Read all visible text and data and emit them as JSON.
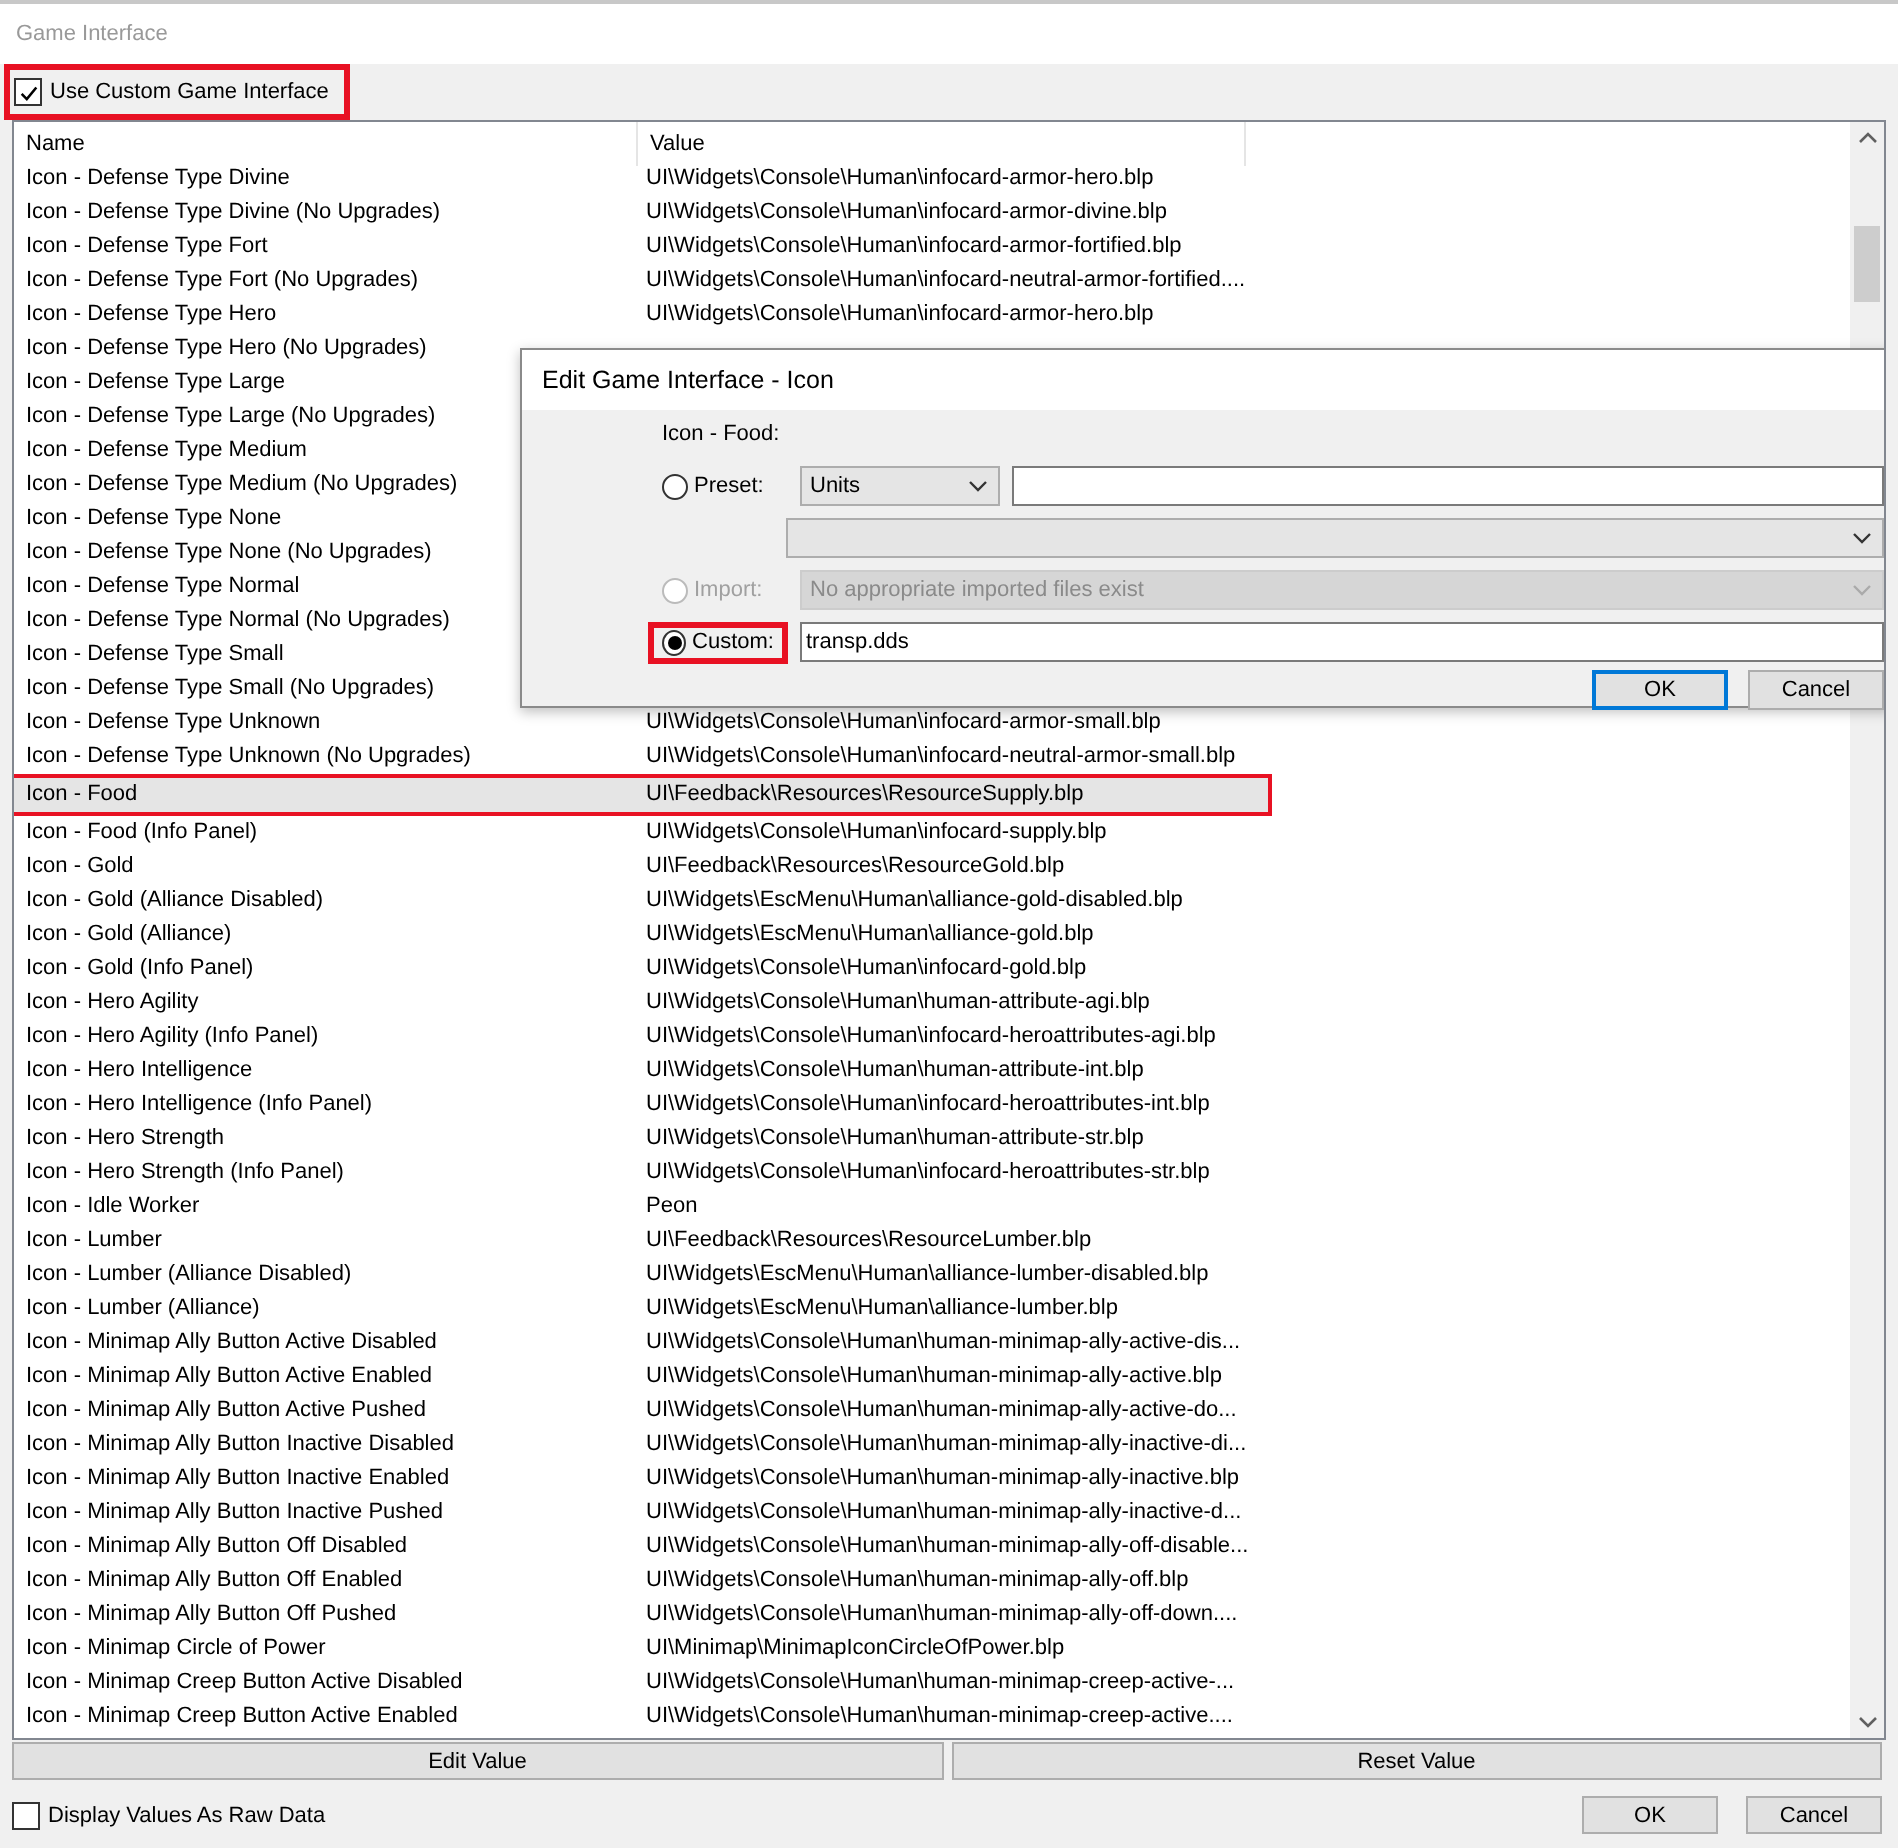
{
  "window": {
    "title": "Game Interface"
  },
  "use_custom": {
    "label": "Use Custom Game Interface",
    "checked": true,
    "highlighted": true
  },
  "table": {
    "columns": [
      "Name",
      "Value"
    ],
    "rows": [
      {
        "name": "Icon - Defense Type Divine",
        "value": "UI\\Widgets\\Console\\Human\\infocard-armor-hero.blp",
        "selected": false,
        "highlighted": false
      },
      {
        "name": "Icon - Defense Type Divine (No Upgrades)",
        "value": "UI\\Widgets\\Console\\Human\\infocard-armor-divine.blp",
        "selected": false,
        "highlighted": false
      },
      {
        "name": "Icon - Defense Type Fort",
        "value": "UI\\Widgets\\Console\\Human\\infocard-armor-fortified.blp",
        "selected": false,
        "highlighted": false
      },
      {
        "name": "Icon - Defense Type Fort (No Upgrades)",
        "value": "UI\\Widgets\\Console\\Human\\infocard-neutral-armor-fortified....",
        "selected": false,
        "highlighted": false
      },
      {
        "name": "Icon - Defense Type Hero",
        "value": "UI\\Widgets\\Console\\Human\\infocard-armor-hero.blp",
        "selected": false,
        "highlighted": false
      },
      {
        "name": "Icon - Defense Type Hero (No Upgrades)",
        "selected": false,
        "highlighted": false
      },
      {
        "name": "Icon - Defense Type Large",
        "selected": false,
        "highlighted": false
      },
      {
        "name": "Icon - Defense Type Large (No Upgrades)",
        "selected": false,
        "highlighted": false
      },
      {
        "name": "Icon - Defense Type Medium",
        "selected": false,
        "highlighted": false
      },
      {
        "name": "Icon - Defense Type Medium (No Upgrades)",
        "selected": false,
        "highlighted": false
      },
      {
        "name": "Icon - Defense Type None",
        "selected": false,
        "highlighted": false
      },
      {
        "name": "Icon - Defense Type None (No Upgrades)",
        "selected": false,
        "highlighted": false
      },
      {
        "name": "Icon - Defense Type Normal",
        "selected": false,
        "highlighted": false
      },
      {
        "name": "Icon - Defense Type Normal (No Upgrades)",
        "selected": false,
        "highlighted": false
      },
      {
        "name": "Icon - Defense Type Small",
        "selected": false,
        "highlighted": false
      },
      {
        "name": "Icon - Defense Type Small (No Upgrades)",
        "selected": false,
        "highlighted": false
      },
      {
        "name": "Icon - Defense Type Unknown",
        "value": "UI\\Widgets\\Console\\Human\\infocard-armor-small.blp",
        "selected": false,
        "highlighted": false
      },
      {
        "name": "Icon - Defense Type Unknown (No Upgrades)",
        "value": "UI\\Widgets\\Console\\Human\\infocard-neutral-armor-small.blp",
        "selected": false,
        "highlighted": false
      },
      {
        "name": "Icon - Food",
        "value": "UI\\Feedback\\Resources\\ResourceSupply.blp",
        "selected": true,
        "highlighted": true
      },
      {
        "name": "Icon - Food (Info Panel)",
        "value": "UI\\Widgets\\Console\\Human\\infocard-supply.blp",
        "selected": false,
        "highlighted": false
      },
      {
        "name": "Icon - Gold",
        "value": "UI\\Feedback\\Resources\\ResourceGold.blp",
        "selected": false,
        "highlighted": false
      },
      {
        "name": "Icon - Gold (Alliance Disabled)",
        "value": "UI\\Widgets\\EscMenu\\Human\\alliance-gold-disabled.blp",
        "selected": false,
        "highlighted": false
      },
      {
        "name": "Icon - Gold (Alliance)",
        "value": "UI\\Widgets\\EscMenu\\Human\\alliance-gold.blp",
        "selected": false,
        "highlighted": false
      },
      {
        "name": "Icon - Gold (Info Panel)",
        "value": "UI\\Widgets\\Console\\Human\\infocard-gold.blp",
        "selected": false,
        "highlighted": false
      },
      {
        "name": "Icon - Hero Agility",
        "value": "UI\\Widgets\\Console\\Human\\human-attribute-agi.blp",
        "selected": false,
        "highlighted": false
      },
      {
        "name": "Icon - Hero Agility (Info Panel)",
        "value": "UI\\Widgets\\Console\\Human\\infocard-heroattributes-agi.blp",
        "selected": false,
        "highlighted": false
      },
      {
        "name": "Icon - Hero Intelligence",
        "value": "UI\\Widgets\\Console\\Human\\human-attribute-int.blp",
        "selected": false,
        "highlighted": false
      },
      {
        "name": "Icon - Hero Intelligence (Info Panel)",
        "value": "UI\\Widgets\\Console\\Human\\infocard-heroattributes-int.blp",
        "selected": false,
        "highlighted": false
      },
      {
        "name": "Icon - Hero Strength",
        "value": "UI\\Widgets\\Console\\Human\\human-attribute-str.blp",
        "selected": false,
        "highlighted": false
      },
      {
        "name": "Icon - Hero Strength (Info Panel)",
        "value": "UI\\Widgets\\Console\\Human\\infocard-heroattributes-str.blp",
        "selected": false,
        "highlighted": false
      },
      {
        "name": "Icon - Idle Worker",
        "value": "Peon",
        "selected": false,
        "highlighted": false
      },
      {
        "name": "Icon - Lumber",
        "value": "UI\\Feedback\\Resources\\ResourceLumber.blp",
        "selected": false,
        "highlighted": false
      },
      {
        "name": "Icon - Lumber (Alliance Disabled)",
        "value": "UI\\Widgets\\EscMenu\\Human\\alliance-lumber-disabled.blp",
        "selected": false,
        "highlighted": false
      },
      {
        "name": "Icon - Lumber (Alliance)",
        "value": "UI\\Widgets\\EscMenu\\Human\\alliance-lumber.blp",
        "selected": false,
        "highlighted": false
      },
      {
        "name": "Icon - Minimap Ally Button Active Disabled",
        "value": "UI\\Widgets\\Console\\Human\\human-minimap-ally-active-dis...",
        "selected": false,
        "highlighted": false
      },
      {
        "name": "Icon - Minimap Ally Button Active Enabled",
        "value": "UI\\Widgets\\Console\\Human\\human-minimap-ally-active.blp",
        "selected": false,
        "highlighted": false
      },
      {
        "name": "Icon - Minimap Ally Button Active Pushed",
        "value": "UI\\Widgets\\Console\\Human\\human-minimap-ally-active-do...",
        "selected": false,
        "highlighted": false
      },
      {
        "name": "Icon - Minimap Ally Button Inactive Disabled",
        "value": "UI\\Widgets\\Console\\Human\\human-minimap-ally-inactive-di...",
        "selected": false,
        "highlighted": false
      },
      {
        "name": "Icon - Minimap Ally Button Inactive Enabled",
        "value": "UI\\Widgets\\Console\\Human\\human-minimap-ally-inactive.blp",
        "selected": false,
        "highlighted": false
      },
      {
        "name": "Icon - Minimap Ally Button Inactive Pushed",
        "value": "UI\\Widgets\\Console\\Human\\human-minimap-ally-inactive-d...",
        "selected": false,
        "highlighted": false
      },
      {
        "name": "Icon - Minimap Ally Button Off Disabled",
        "value": "UI\\Widgets\\Console\\Human\\human-minimap-ally-off-disable...",
        "selected": false,
        "highlighted": false
      },
      {
        "name": "Icon - Minimap Ally Button Off Enabled",
        "value": "UI\\Widgets\\Console\\Human\\human-minimap-ally-off.blp",
        "selected": false,
        "highlighted": false
      },
      {
        "name": "Icon - Minimap Ally Button Off Pushed",
        "value": "UI\\Widgets\\Console\\Human\\human-minimap-ally-off-down....",
        "selected": false,
        "highlighted": false
      },
      {
        "name": "Icon - Minimap Circle of Power",
        "value": "UI\\Minimap\\MinimapIconCircleOfPower.blp",
        "selected": false,
        "highlighted": false
      },
      {
        "name": "Icon - Minimap Creep Button Active Disabled",
        "value": "UI\\Widgets\\Console\\Human\\human-minimap-creep-active-...",
        "selected": false,
        "highlighted": false
      },
      {
        "name": "Icon - Minimap Creep Button Active Enabled",
        "value": "UI\\Widgets\\Console\\Human\\human-minimap-creep-active....",
        "selected": false,
        "highlighted": false
      }
    ]
  },
  "dialog": {
    "title": "Edit Game Interface - Icon",
    "label": "Icon - Food:",
    "options": [
      {
        "kind": "preset",
        "label": "Preset:",
        "selected": false,
        "disabled": false,
        "highlighted": false,
        "select_value": "Units"
      },
      {
        "kind": "import",
        "label": "Import:",
        "selected": false,
        "disabled": true,
        "highlighted": false,
        "select_value": "No appropriate imported files exist"
      },
      {
        "kind": "custom",
        "label": "Custom:",
        "selected": true,
        "disabled": false,
        "highlighted": true,
        "text": "transp.dds"
      }
    ],
    "buttons": [
      {
        "label": "OK",
        "default": true
      },
      {
        "label": "Cancel",
        "default": false
      }
    ]
  },
  "row_buttons": [
    "Edit Value",
    "Reset Value"
  ],
  "raw_data": {
    "label": "Display Values As Raw Data",
    "checked": false
  },
  "buttons": [
    "OK",
    "Cancel"
  ]
}
